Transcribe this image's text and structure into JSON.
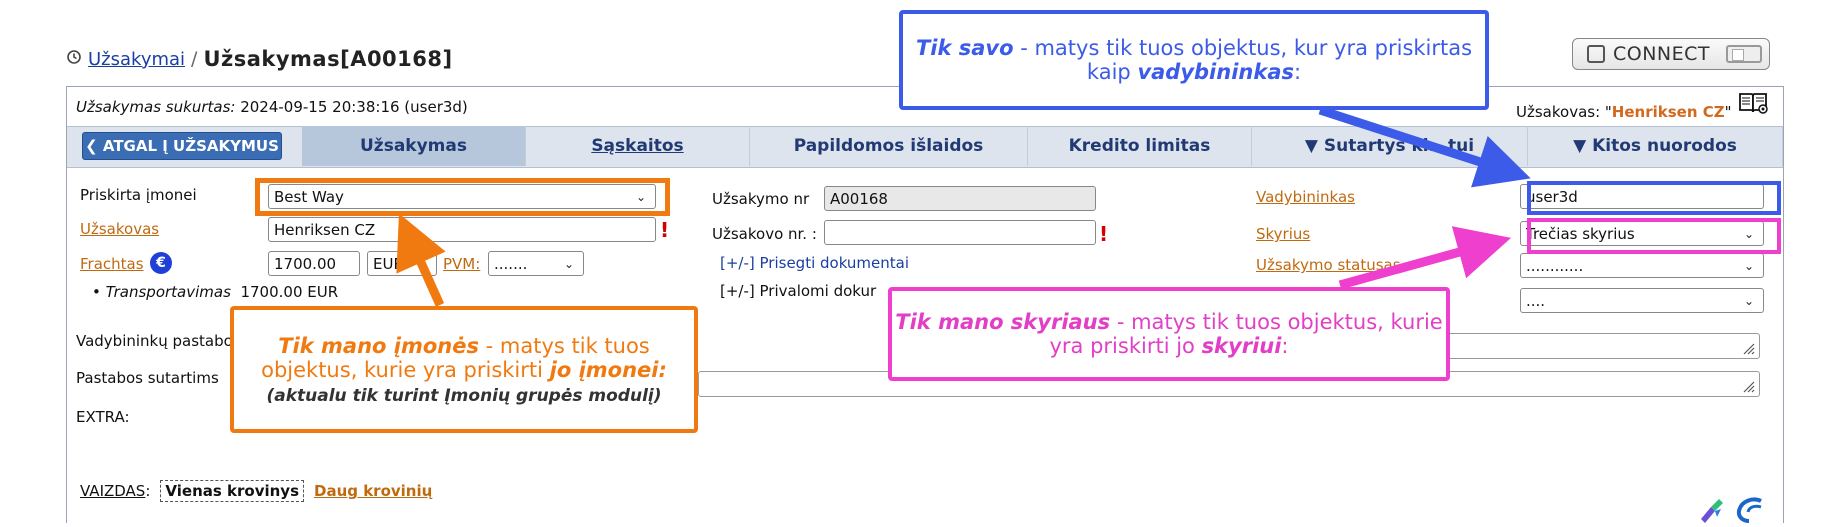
{
  "breadcrumb": {
    "parent": "Užsakymai",
    "separator": "/",
    "current": "Užsakymas[A00168]"
  },
  "connect": {
    "label": "CONNECT"
  },
  "header": {
    "created_label": "Užsakymas sukurtas:",
    "created_value": "2024-09-15 20:38:16 (user3d)",
    "customer_label": "Užsakovas: \"",
    "customer_value": "Henriksen CZ",
    "customer_end": "\""
  },
  "tabs": {
    "back": "❮ ATGAL Į UŽSAKYMUS",
    "items": [
      "Užsakymas",
      "Sąskaitos",
      "Papildomos išlaidos",
      "Kredito limitas",
      "▼ Sutartys kl...tui",
      "▼ Kitos nuorodos"
    ]
  },
  "form": {
    "company_label": "Priskirta įmonei",
    "company_value": "Best Way",
    "customer_label": "Užsakovas",
    "customer_value": "Henriksen CZ",
    "freight_label": "Frachtas",
    "freight_value": "1700.00",
    "currency": "EUR",
    "vat_label": "PVM:",
    "vat_value": ".......",
    "transport_label": "Transportavimas",
    "transport_value": "1700.00 EUR",
    "order_no_label": "Užsakymo nr",
    "order_no_value": "A00168",
    "customer_no_label": "Užsakovo nr. :",
    "customer_no_value": "",
    "attach_docs": "[+/-] Prisegti dokumentai",
    "required_docs": "[+/-] Privalomi dokur",
    "manager_label": "Vadybininkas",
    "manager_value": "user3d",
    "dept_label": "Skyrius",
    "dept_value": "Trečias skyrius",
    "status_label": "Užsakymo statusas",
    "status_value": "............",
    "extra_select": "....",
    "managers_notes_label": "Vadybininkų pastabo",
    "contract_notes_label": "Pastabos sutartims",
    "extra_label": "EXTRA:"
  },
  "annotations": {
    "blue_bold": "Tik savo",
    "blue_text": " - matys tik tuos objektus, kur yra priskirtas kaip ",
    "blue_bold2": "vadybininkas",
    "blue_end": ":",
    "orange_bold": "Tik mano įmonės",
    "orange_text": " - matys tik tuos objektus, kurie yra priskirti ",
    "orange_bold2": "jo įmonei:",
    "orange_sub": "(aktualu tik turint Įmonių grupės modulį)",
    "pink_bold": "Tik mano skyriaus",
    "pink_text": " - matys tik tuos objektus, kurie yra priskirti jo ",
    "pink_bold2": "skyriui",
    "pink_end": ":"
  },
  "views": {
    "label": "VAIZDAS",
    "active": "Vienas krovinys",
    "other": "Daug krovinių"
  },
  "colors": {
    "blue": "#3b5be8",
    "orange": "#f07a10",
    "pink": "#ee3fcf",
    "tab_bg": "#dde4ee"
  }
}
